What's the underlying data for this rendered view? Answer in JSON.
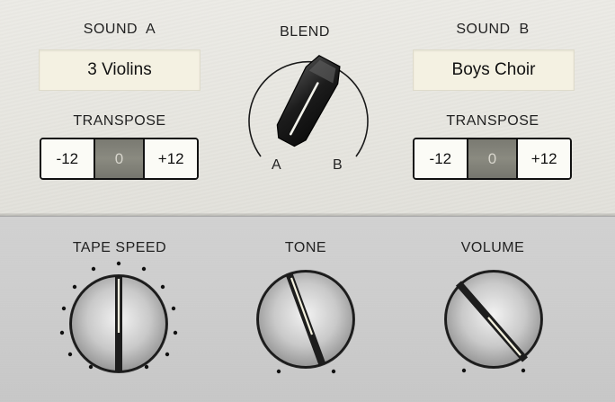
{
  "sound_a": {
    "title": "SOUND  A",
    "value": "3 Violins"
  },
  "sound_b": {
    "title": "SOUND  B",
    "value": "Boys Choir"
  },
  "blend": {
    "title": "BLEND",
    "label_a": "A",
    "label_b": "B"
  },
  "transpose_a": {
    "title": "TRANSPOSE",
    "minus": "-12",
    "value": "0",
    "plus": "+12"
  },
  "transpose_b": {
    "title": "TRANSPOSE",
    "minus": "-12",
    "value": "0",
    "plus": "+12"
  },
  "knobs": {
    "tape_speed": {
      "title": "TAPE SPEED"
    },
    "tone": {
      "title": "TONE"
    },
    "volume": {
      "title": "VOLUME"
    }
  }
}
